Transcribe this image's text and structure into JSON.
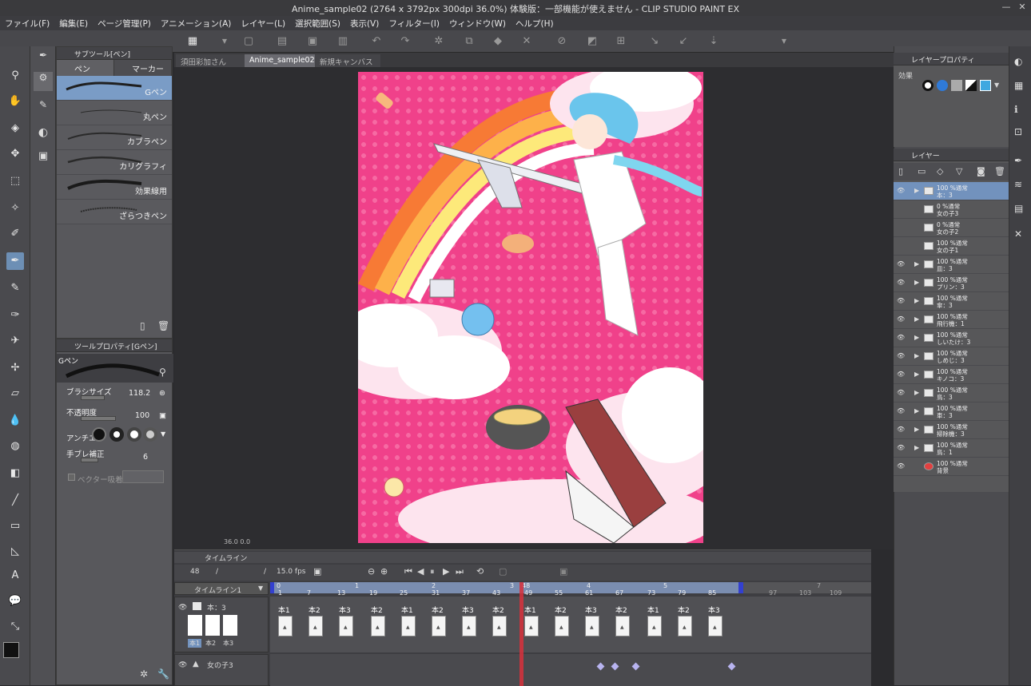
{
  "window": {
    "title": "Anime_sample02 (2764 x 3792px 300dpi 36.0%) 体験版：一部機能が使えません - CLIP STUDIO PAINT EX",
    "minimize": "—",
    "close": "✕"
  },
  "menu": [
    "ファイル(F)",
    "編集(E)",
    "ページ管理(P)",
    "アニメーション(A)",
    "レイヤー(L)",
    "選択範囲(S)",
    "表示(V)",
    "フィルター(I)",
    "ウィンドウ(W)",
    "ヘルプ(H)"
  ],
  "subtool": {
    "header": "サブツール[ペン]",
    "tabs": [
      "ペン",
      "マーカー"
    ],
    "brushes": [
      "Gペン",
      "丸ペン",
      "カブラペン",
      "カリグラフィ",
      "効果線用",
      "ざらつきペン"
    ],
    "selected_brush": "Gペン"
  },
  "toolprop": {
    "header": "ツールプロパティ[Gペン]",
    "brush_name": "Gペン",
    "brush_size_label": "ブラシサイズ",
    "brush_size_value": "118.2",
    "opacity_label": "不透明度",
    "opacity_value": "100",
    "antialias_label": "アンチエ",
    "stabilization_label": "手ブレ補正",
    "stabilization_value": "6",
    "vector_label": "ベクター吸着"
  },
  "doc_tabs": [
    "須田彩加さん",
    "Anime_sample02",
    "新規キャンバス*"
  ],
  "selected_doc_tab": "Anime_sample02",
  "canvas": {
    "zoom_readout": "36.0 0.0"
  },
  "timeline": {
    "header": "タイムライン",
    "current_frame": "48",
    "slash1": "/",
    "slash2": "/",
    "fps": "15.0 fps",
    "timeline_name": "タイムライン1",
    "ruler_ticks": [
      "1",
      "7",
      "13",
      "19",
      "25",
      "31",
      "37",
      "43",
      "49",
      "55",
      "61",
      "67",
      "73",
      "79",
      "85",
      "97",
      "103",
      "109"
    ],
    "ruler_seconds": [
      "0",
      "1",
      "2",
      "3",
      "48",
      "4",
      "5",
      "7"
    ],
    "tracks": [
      {
        "name": "本：3",
        "thumbs": [
          "本1",
          "本2",
          "本3"
        ]
      },
      {
        "name": "女の子3"
      }
    ],
    "cel_labels": [
      "本1",
      "本2",
      "本3",
      "本2",
      "本1",
      "本2",
      "本3",
      "本2",
      "本1",
      "本2",
      "本3",
      "本2",
      "本1",
      "本2",
      "本3"
    ]
  },
  "layer_property": {
    "header": "レイヤープロパティ",
    "effect_label": "効果"
  },
  "layers": {
    "header": "レイヤー",
    "rows": [
      {
        "l1": "100 %通常",
        "l2": "本：3",
        "selected": true
      },
      {
        "l1": "0 %通常",
        "l2": "女の子3",
        "selected": false
      },
      {
        "l1": "0 %通常",
        "l2": "女の子2",
        "selected": false
      },
      {
        "l1": "100 %通常",
        "l2": "女の子1",
        "selected": false
      },
      {
        "l1": "100 %通常",
        "l2": "皿：3",
        "selected": false
      },
      {
        "l1": "100 %通常",
        "l2": "プリン：3",
        "selected": false
      },
      {
        "l1": "100 %通常",
        "l2": "傘：3",
        "selected": false
      },
      {
        "l1": "100 %通常",
        "l2": "飛行機：1",
        "selected": false
      },
      {
        "l1": "100 %通常",
        "l2": "しいたけ：3",
        "selected": false
      },
      {
        "l1": "100 %通常",
        "l2": "しめじ：3",
        "selected": false
      },
      {
        "l1": "100 %通常",
        "l2": "キノコ：3",
        "selected": false
      },
      {
        "l1": "100 %通常",
        "l2": "鳥：3",
        "selected": false
      },
      {
        "l1": "100 %通常",
        "l2": "車：3",
        "selected": false
      },
      {
        "l1": "100 %通常",
        "l2": "掃除機：3",
        "selected": false
      },
      {
        "l1": "100 %通常",
        "l2": "鳥：1",
        "selected": false
      },
      {
        "l1": "100 %通常",
        "l2": "背景",
        "selected": false
      }
    ]
  },
  "colors": {
    "accent": "#6d8fb5",
    "artboard_pink": "#f0418a",
    "playhead": "#d8303c"
  }
}
